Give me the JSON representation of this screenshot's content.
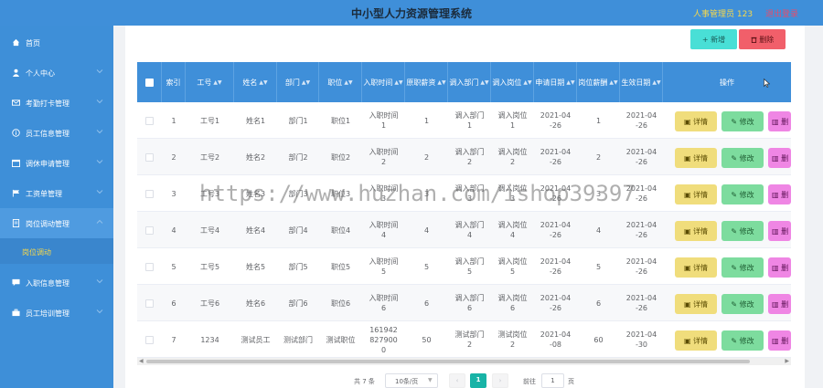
{
  "header": {
    "title": "中小型人力资源管理系统",
    "user": "人事管理员 123",
    "logout": "退出登录"
  },
  "sidebar": {
    "items": [
      {
        "label": "首页",
        "icon": "home-icon",
        "has_chevron": false
      },
      {
        "label": "个人中心",
        "icon": "user-icon",
        "has_chevron": true
      },
      {
        "label": "考勤打卡管理",
        "icon": "mail-icon",
        "has_chevron": true
      },
      {
        "label": "员工信息管理",
        "icon": "info-icon",
        "has_chevron": true
      },
      {
        "label": "调休申请管理",
        "icon": "calendar-icon",
        "has_chevron": true
      },
      {
        "label": "工资单管理",
        "icon": "flag-icon",
        "has_chevron": true
      },
      {
        "label": "岗位调动管理",
        "icon": "document-icon",
        "has_chevron": true,
        "active": true
      }
    ],
    "sub_item": "岗位调动",
    "items_after": [
      {
        "label": "入职信息管理",
        "icon": "chat-icon",
        "has_chevron": true
      },
      {
        "label": "员工培训管理",
        "icon": "briefcase-icon",
        "has_chevron": true
      }
    ]
  },
  "toolbar": {
    "add_label": "+ 新增",
    "delete_label": "删除"
  },
  "table": {
    "columns": [
      "索引",
      "工号",
      "姓名",
      "部门",
      "职位",
      "入职时间",
      "原职薪资",
      "调入部门",
      "调入岗位",
      "申请日期",
      "岗位薪酬",
      "生效日期",
      "操作"
    ],
    "rows": [
      {
        "idx": "1",
        "id": "工号1",
        "name": "姓名1",
        "dept": "部门1",
        "pos": "职位1",
        "hired": "入职时间1",
        "salary": "1",
        "to_dept": "调入部门1",
        "to_pos": "调入岗位1",
        "apply": "2021-04-26",
        "new_salary": "1",
        "effective": "2021-04-26"
      },
      {
        "idx": "2",
        "id": "工号2",
        "name": "姓名2",
        "dept": "部门2",
        "pos": "职位2",
        "hired": "入职时间2",
        "salary": "2",
        "to_dept": "调入部门2",
        "to_pos": "调入岗位2",
        "apply": "2021-04-26",
        "new_salary": "2",
        "effective": "2021-04-26"
      },
      {
        "idx": "3",
        "id": "工号3",
        "name": "姓名3",
        "dept": "部门3",
        "pos": "职位3",
        "hired": "入职时间3",
        "salary": "3",
        "to_dept": "调入部门3",
        "to_pos": "调入岗位3",
        "apply": "2021-04-26",
        "new_salary": "3",
        "effective": "2021-04-26"
      },
      {
        "idx": "4",
        "id": "工号4",
        "name": "姓名4",
        "dept": "部门4",
        "pos": "职位4",
        "hired": "入职时间4",
        "salary": "4",
        "to_dept": "调入部门4",
        "to_pos": "调入岗位4",
        "apply": "2021-04-26",
        "new_salary": "4",
        "effective": "2021-04-26"
      },
      {
        "idx": "5",
        "id": "工号5",
        "name": "姓名5",
        "dept": "部门5",
        "pos": "职位5",
        "hired": "入职时间5",
        "salary": "5",
        "to_dept": "调入部门5",
        "to_pos": "调入岗位5",
        "apply": "2021-04-26",
        "new_salary": "5",
        "effective": "2021-04-26"
      },
      {
        "idx": "6",
        "id": "工号6",
        "name": "姓名6",
        "dept": "部门6",
        "pos": "职位6",
        "hired": "入职时间6",
        "salary": "6",
        "to_dept": "调入部门6",
        "to_pos": "调入岗位6",
        "apply": "2021-04-26",
        "new_salary": "6",
        "effective": "2021-04-26"
      },
      {
        "idx": "7",
        "id": "1234",
        "name": "测试员工",
        "dept": "测试部门",
        "pos": "测试职位",
        "hired": "1619428279000",
        "salary": "50",
        "to_dept": "测试部门2",
        "to_pos": "测试岗位2",
        "apply": "2021-04-08",
        "new_salary": "60",
        "effective": "2021-04-30"
      }
    ],
    "actions": {
      "detail": "详情",
      "edit": "修改",
      "more": "删"
    }
  },
  "pagination": {
    "total": "共 7 条",
    "page_size": "10条/页",
    "current_page": "1",
    "goto_label": "前往",
    "goto_value": "1",
    "unit": "页"
  },
  "watermark": "https://www.huzhan.com/ishop39397",
  "colors": {
    "header_bg": "#3f8fd9",
    "sidebar_bg": "#3e8fd8",
    "add_btn": "#49dfd6",
    "delete_btn": "#f15f6a",
    "detail_btn": "#f0dd7c",
    "edit_btn": "#7ddc9e",
    "more_btn": "#ef86e4",
    "page_active": "#18b3a6"
  }
}
